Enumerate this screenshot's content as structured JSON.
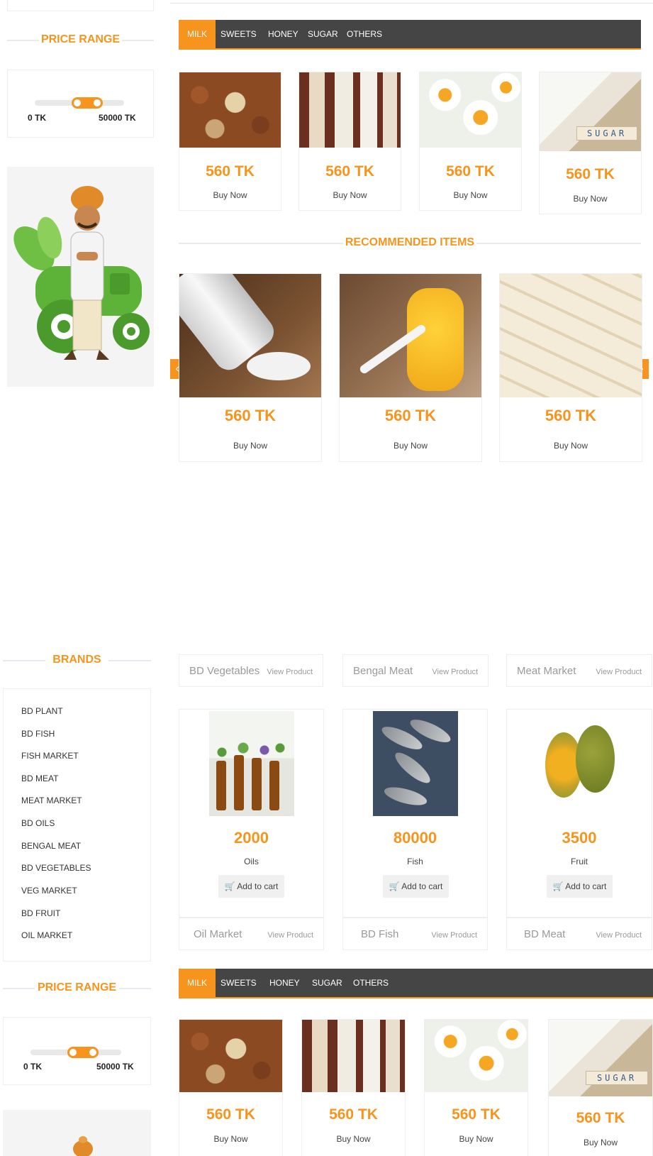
{
  "sidebar": {
    "price_range_title": "PRICE RANGE",
    "range_min_label": "0 TK",
    "range_max_label": "50000 TK",
    "brands_title": "BRANDS",
    "brands": [
      "BD PLANT",
      "BD FISH",
      "FISH MARKET",
      "BD MEAT",
      "MEAT MARKET",
      "BD OILS",
      "BENGAL MEAT",
      "BD VEGETABLES",
      "VEG MARKET",
      "BD FRUIT",
      "OIL MARKET"
    ]
  },
  "category_tabs": [
    {
      "label": "MILK",
      "active": true
    },
    {
      "label": "SWEETS",
      "active": false
    },
    {
      "label": "HONEY",
      "active": false
    },
    {
      "label": "SUGAR",
      "active": false
    },
    {
      "label": "OTHERS",
      "active": false
    }
  ],
  "tab_products": [
    {
      "image": "nuts",
      "price": "560 TK",
      "cta": "Buy Now"
    },
    {
      "image": "milk-glasses",
      "price": "560 TK",
      "cta": "Buy Now"
    },
    {
      "image": "boiled-eggs",
      "price": "560 TK",
      "cta": "Buy Now"
    },
    {
      "image": "sugar-cubes",
      "price": "560 TK",
      "cta": "Buy Now"
    }
  ],
  "recommended": {
    "title": "RECOMMENDED ITEMS",
    "prev_icon": "‹",
    "next_icon": "›",
    "items": [
      {
        "image": "salt-shaker",
        "price": "560 TK",
        "cta": "Buy Now"
      },
      {
        "image": "ghee-jar",
        "price": "560 TK",
        "cta": "Buy Now"
      },
      {
        "image": "sweets-plate",
        "price": "560 TK",
        "cta": "Buy Now"
      }
    ]
  },
  "brand_strip_top": [
    {
      "name": "BD Vegetables",
      "link": "View Product"
    },
    {
      "name": "Bengal Meat",
      "link": "View Product"
    },
    {
      "name": "Meat Market",
      "link": "View Product"
    }
  ],
  "featured_products": [
    {
      "image": "oil-bottles",
      "price": "2000",
      "category": "Oils",
      "cta": "Add to cart"
    },
    {
      "image": "fish",
      "price": "80000",
      "category": "Fish",
      "cta": "Add to cart"
    },
    {
      "image": "jackfruit",
      "price": "3500",
      "category": "Fruit",
      "cta": "Add to cart"
    }
  ],
  "brand_strip_bottom": [
    {
      "name": "Oil Market",
      "link": "View Product"
    },
    {
      "name": "BD Fish",
      "link": "View Product"
    },
    {
      "name": "BD Meat",
      "link": "View Product"
    }
  ],
  "colors": {
    "accent": "#f7941d",
    "tabbar": "#454545"
  }
}
